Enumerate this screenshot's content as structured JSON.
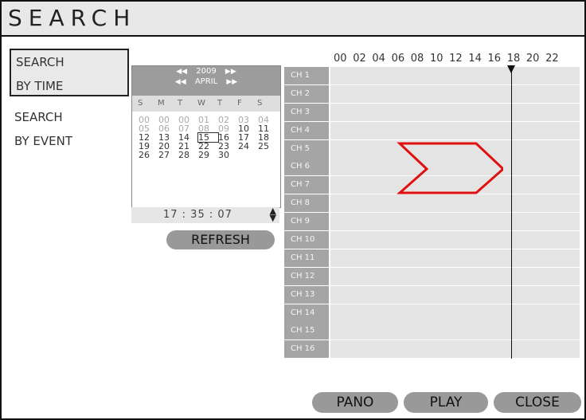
{
  "header": {
    "title": "SEARCH"
  },
  "sidebar": {
    "by_time_line1": "SEARCH",
    "by_time_line2": "BY TIME",
    "by_event_line1": "SEARCH",
    "by_event_line2": "BY EVENT"
  },
  "calendar": {
    "year": "2009",
    "month": "APRIL",
    "weekdays": [
      "S",
      "M",
      "T",
      "W",
      "T",
      "F",
      "S"
    ],
    "weeks": [
      [
        "00",
        "00",
        "00",
        "01",
        "02",
        "03",
        "04"
      ],
      [
        "05",
        "06",
        "07",
        "08",
        "09",
        "10",
        "11"
      ],
      [
        "12",
        "13",
        "14",
        "15",
        "16",
        "17",
        "18"
      ],
      [
        "19",
        "20",
        "21",
        "22",
        "23",
        "24",
        "25"
      ],
      [
        "26",
        "27",
        "28",
        "29",
        "30",
        "",
        ""
      ]
    ],
    "selected_day": "15"
  },
  "time": {
    "value": "17 : 35 : 07"
  },
  "buttons": {
    "refresh": "REFRESH",
    "pano": "PANO",
    "play": "PLAY",
    "close": "CLOSE"
  },
  "timeline": {
    "hours": [
      "00",
      "02",
      "04",
      "06",
      "08",
      "10",
      "12",
      "14",
      "16",
      "18",
      "20",
      "22"
    ],
    "channels": [
      "CH 1",
      "CH 2",
      "CH 3",
      "CH 4",
      "CH 5",
      "CH 6",
      "CH 7",
      "CH 8",
      "CH 9",
      "CH 10",
      "CH 11",
      "CH 12",
      "CH 13",
      "CH 14",
      "CH 15",
      "CH 16"
    ],
    "cursor_hour": 17.6
  },
  "colors": {
    "arrow_outline": "#e01010",
    "track": "#e4e4e4",
    "label_bg": "#a5a5a5"
  },
  "icons": [
    "prev-year-icon",
    "next-year-icon",
    "prev-month-icon",
    "next-month-icon",
    "time-spinner-icon",
    "playhead-marker-icon"
  ]
}
